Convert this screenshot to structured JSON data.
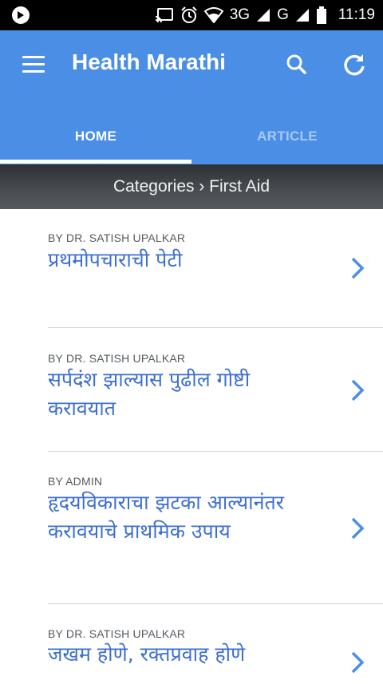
{
  "status_bar": {
    "network_3g": "3G",
    "network_g": "G",
    "time": "11:19"
  },
  "app_bar": {
    "title": "Health Marathi",
    "tabs": [
      {
        "label": "HOME",
        "active": true
      },
      {
        "label": "ARTICLE",
        "active": false
      }
    ],
    "icons": [
      "menu-icon",
      "search-icon",
      "refresh-icon"
    ]
  },
  "breadcrumb": {
    "text": "Categories › First Aid"
  },
  "articles": [
    {
      "author": "BY DR. SATISH UPALKAR",
      "title": "प्रथमोपचाराची पेटी"
    },
    {
      "author": "BY DR. SATISH UPALKAR",
      "title": "सर्पदंश झाल्यास पुढील गोष्टी करावयात"
    },
    {
      "author": "BY ADMIN",
      "title": "हृदयविकाराचा झटका आल्यानंतर करावयाचे प्राथमिक उपाय"
    },
    {
      "author": "BY DR. SATISH UPALKAR",
      "title": "जखम होणे, रक्तप्रवाह होणे"
    }
  ],
  "colors": {
    "primary": "#4a8ee6",
    "title_text": "#3d6fd2",
    "chevron": "#4a8ee6"
  }
}
